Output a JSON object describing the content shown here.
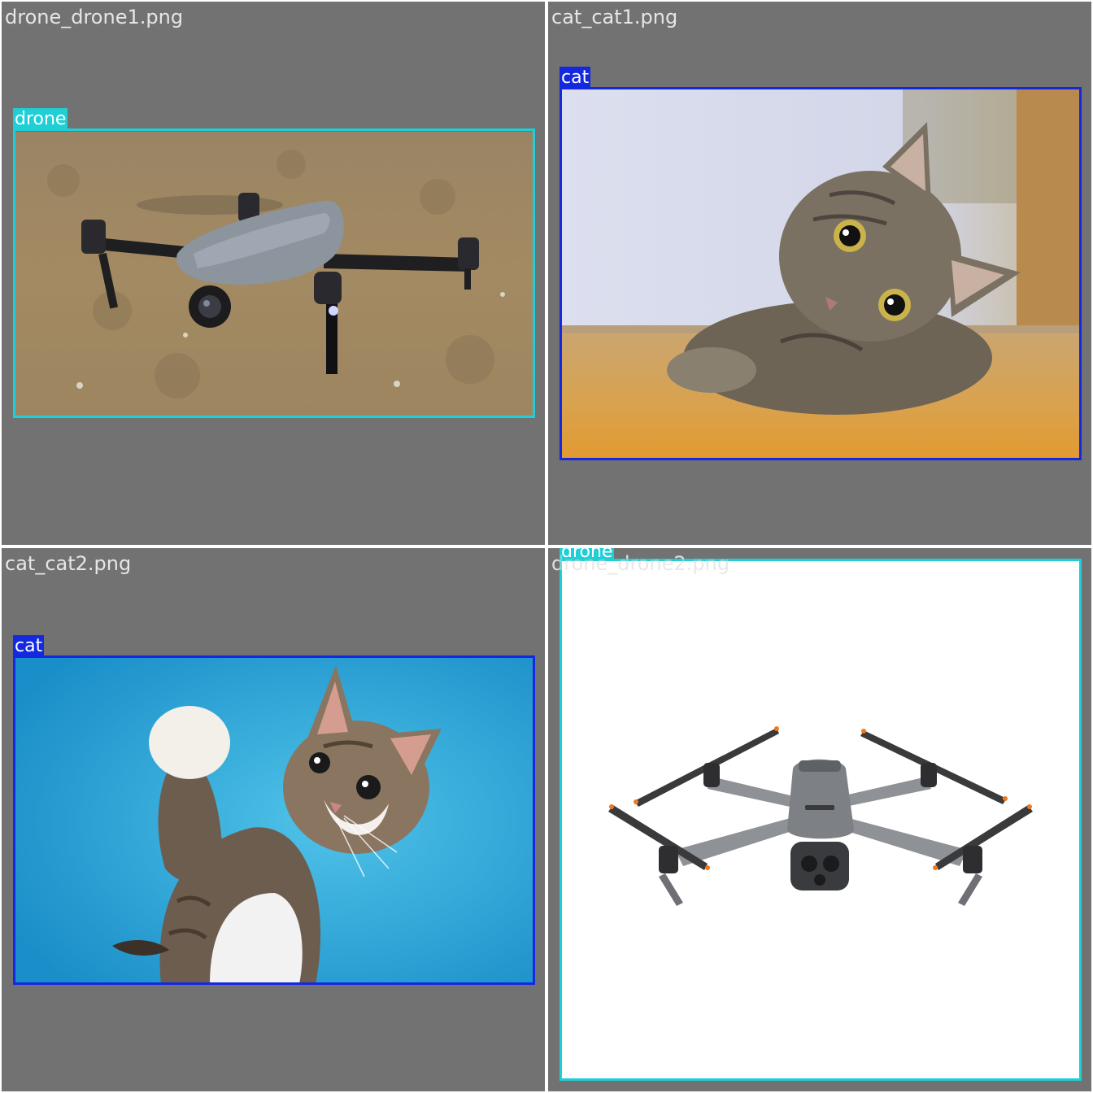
{
  "tiles": [
    {
      "filename": "drone_drone1.png",
      "detection": {
        "label": "drone",
        "color": "#1ecfd6"
      }
    },
    {
      "filename": "cat_cat1.png",
      "detection": {
        "label": "cat",
        "color": "#1428e0"
      }
    },
    {
      "filename": "cat_cat2.png",
      "detection": {
        "label": "cat",
        "color": "#1428e0"
      }
    },
    {
      "filename": "drone_drone2.png",
      "detection": {
        "label": "drone",
        "color": "#1ecfd6"
      }
    }
  ],
  "colors": {
    "background": "#727272",
    "grid_line": "#ffffff",
    "drone": "#1ecfd6",
    "cat": "#1428e0"
  }
}
